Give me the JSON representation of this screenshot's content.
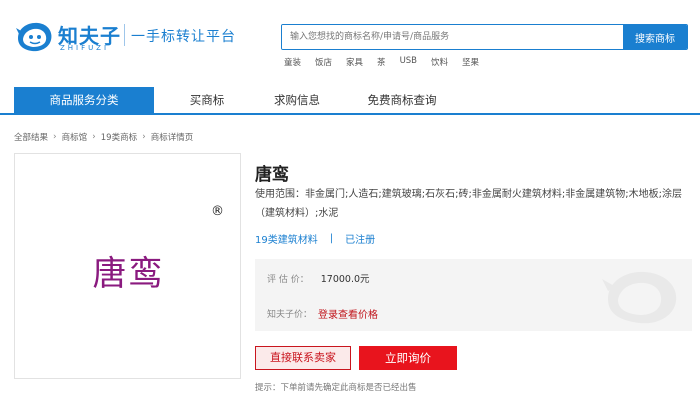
{
  "brand": {
    "name": "知夫子",
    "pinyin": "ZHIFUZI",
    "slogan": "一手标转让平台"
  },
  "search": {
    "placeholder": "输入您想找的商标名称/申请号/商品服务",
    "button_label": "搜索商标",
    "hot_keywords": [
      "童装",
      "饭店",
      "家具",
      "茶",
      "USB",
      "饮料",
      "坚果"
    ]
  },
  "nav": {
    "items": [
      {
        "label": "商品服务分类",
        "active": true
      },
      {
        "label": "买商标",
        "active": false
      },
      {
        "label": "求购信息",
        "active": false
      },
      {
        "label": "免费商标查询",
        "active": false
      }
    ]
  },
  "breadcrumb": [
    "全部结果",
    "商标馆",
    "19类商标",
    "商标详情页"
  ],
  "trademark": {
    "name": "唐鸾",
    "image_text": "唐鸾",
    "registered_mark": "®",
    "scope_label": "使用范围：",
    "scope": "非金属门;人造石;建筑玻璃;石灰石;砖;非金属耐火建筑材料;非金属建筑物;木地板;涂层（建筑材料）;水泥",
    "category": "19类建筑材料",
    "status": "已注册"
  },
  "price": {
    "estimate_label": "评 估 价：",
    "estimate_value": "17000.0元",
    "member_label": "知夫子价：",
    "member_value": "登录查看价格"
  },
  "actions": {
    "contact_label": "直接联系卖家",
    "ask_label": "立即询价"
  },
  "tip": "提示：下单前请先确定此商标是否已经出售",
  "colors": {
    "primary": "#1a7fd0",
    "danger": "#e8141d",
    "trademark_text": "#8a1a7f"
  }
}
